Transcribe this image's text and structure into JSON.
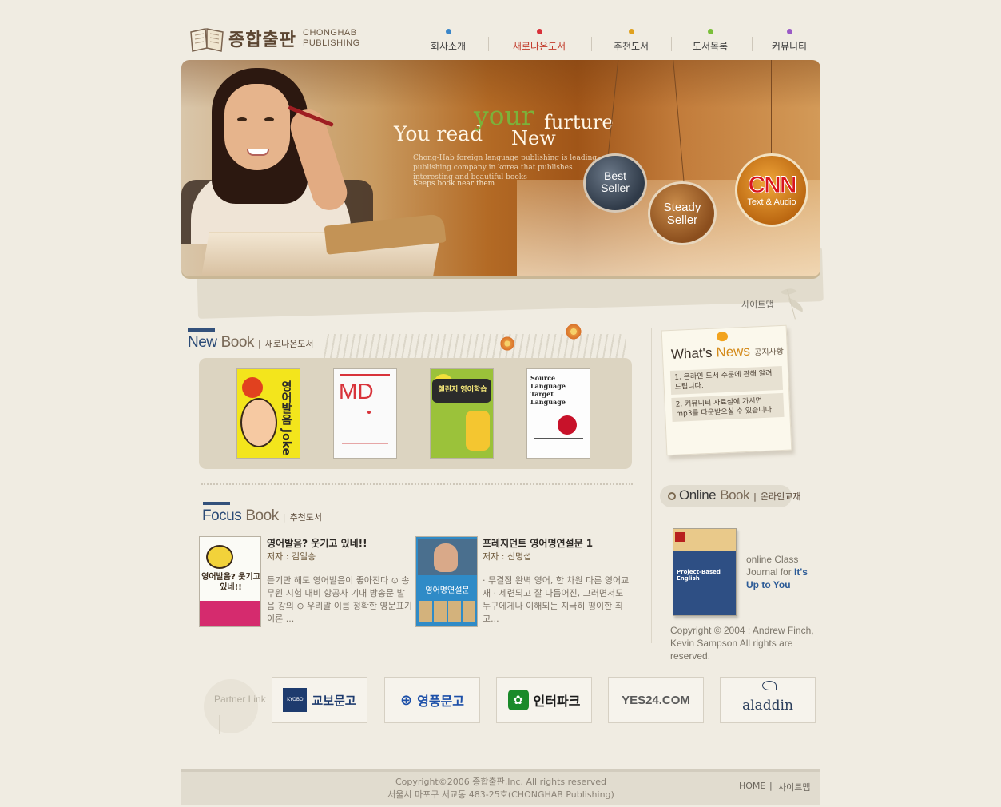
{
  "logo": {
    "ko": "종합출판",
    "en_line1": "CHONGHAB",
    "en_line2": "PUBLISHING"
  },
  "nav": [
    {
      "label": "회사소개",
      "dot_color": "#3a86c9"
    },
    {
      "label": "새로나온도서",
      "dot_color": "#d8313a"
    },
    {
      "label": "추천도서",
      "dot_color": "#e0a11e"
    },
    {
      "label": "도서목록",
      "dot_color": "#7bbf3a"
    },
    {
      "label": "커뮤니티",
      "dot_color": "#9a5ac6"
    }
  ],
  "banner": {
    "tagline_you_read": "You read",
    "tagline_your": "your",
    "tagline_furture": "furture",
    "tagline_new": "New",
    "description": "Chong-Hab foreign language publishing is leading publishing company in korea that publishes interesting and beautiful books",
    "description2": "Keeps book near them",
    "best_seller_1": "Best",
    "best_seller_2": "Seller",
    "steady_seller_1": "Steady",
    "steady_seller_2": "Seller",
    "cnn_logo": "CNN",
    "cnn_sub": "Text & Audio"
  },
  "sitemap_link": "사이트맵",
  "new_book": {
    "title_en_a": "New",
    "title_en_b": "Book",
    "title_ko": "새로나온도서",
    "covers": [
      {
        "title": "영어발음 Joke"
      },
      {
        "title": "MD"
      },
      {
        "title": "첼린지 영어학습"
      },
      {
        "title": "Source Language Target Language"
      }
    ]
  },
  "focus_book": {
    "title_en_a": "Focus",
    "title_en_b": "Book",
    "title_ko": "추천도서",
    "books": [
      {
        "title": "영어발음? 웃기고 있네!!",
        "author": "저자 : 김일승",
        "desc": "듣기만 해도 영어발음이 좋아진다 ⊙ 송무원 시험 대비 항공사 기내 방송문 발음 강의 ⊙ 우리말 이름 정확한 영문표기 이론 ...",
        "cover_text": "영어발음? 웃기고 있네!!"
      },
      {
        "title": "프레지던트 영어명연설문 1",
        "author": "저자 : 신명섭",
        "desc": "· 무결점 완벽 영어, 한 차원 다른 영어교재 · 세련되고 잘 다듬어진, 그러면서도 누구에게나 이해되는 지극히 평이한 최고...",
        "cover_text": "영어명연설문"
      }
    ]
  },
  "news": {
    "title_a": "What's",
    "title_b": "News",
    "title_ko": "공지사항",
    "items": [
      "1. 온라인 도서 주문에 관해 알려드립니다.",
      "2. 커뮤니티 자료실에 가시면 mp3를 다운받으실 수 있습니다."
    ]
  },
  "online_book": {
    "title_en_a": "Online",
    "title_en_b": "Book",
    "title_ko": "온라인교재",
    "caption_1": "online Class",
    "caption_2": "Journal for",
    "caption_3": "It's",
    "caption_4": "Up to You",
    "copyright": "Copyright © 2004 : Andrew Finch, Kevin Sampson All rights are reserved.",
    "cover_text": "Project-Based English"
  },
  "partners": {
    "label": "Partner Link",
    "items": [
      {
        "name": "교보문고",
        "mark": "KYOBO",
        "color": "#1e3b6e"
      },
      {
        "name": "영풍문고",
        "mark": "⊕",
        "color": "#1c4fa8"
      },
      {
        "name": "인터파크",
        "mark": "✿",
        "color": "#1a8a2a"
      },
      {
        "name": "YES24.COM",
        "mark": "",
        "color": "#5a5a5a"
      },
      {
        "name": "aladdin",
        "mark": "",
        "color": "#2b3e5c"
      }
    ]
  },
  "footer": {
    "copyright": "Copyright©2006 종합출판,Inc. All rights reserved",
    "address": "서울시 마포구 서교동 483-25호(CHONGHAB Publishing)",
    "home": "HOME",
    "sep": "|",
    "sitemap": "사이트맵"
  }
}
